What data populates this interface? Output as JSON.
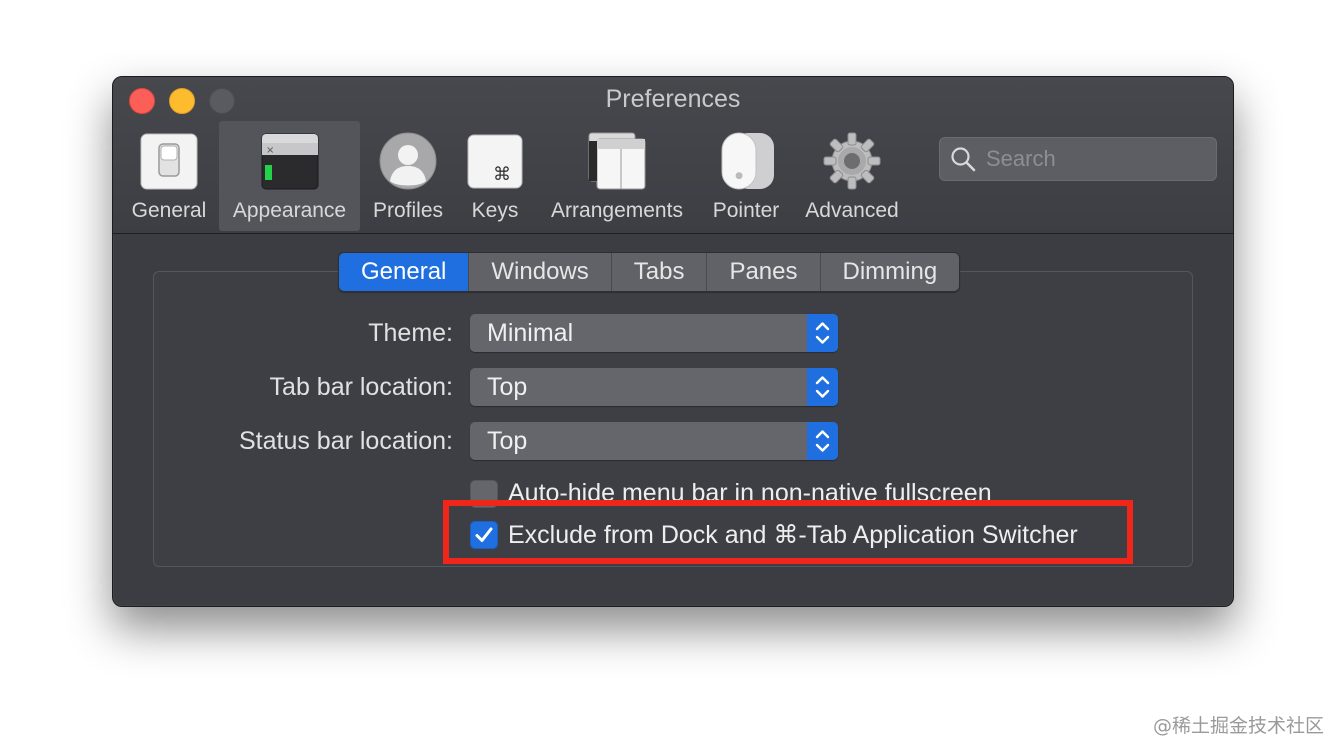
{
  "window": {
    "title": "Preferences"
  },
  "toolbar": {
    "items": [
      {
        "label": "General",
        "icon": "general-switch-icon",
        "selected": false
      },
      {
        "label": "Appearance",
        "icon": "terminal-window-icon",
        "selected": true
      },
      {
        "label": "Profiles",
        "icon": "person-silhouette-icon",
        "selected": false
      },
      {
        "label": "Keys",
        "icon": "command-key-icon",
        "selected": false
      },
      {
        "label": "Arrangements",
        "icon": "windows-arrangement-icon",
        "selected": false
      },
      {
        "label": "Pointer",
        "icon": "mouse-icon",
        "selected": false
      },
      {
        "label": "Advanced",
        "icon": "gear-icon",
        "selected": false
      }
    ]
  },
  "search": {
    "placeholder": "Search"
  },
  "tabs": [
    {
      "label": "General",
      "active": true
    },
    {
      "label": "Windows",
      "active": false
    },
    {
      "label": "Tabs",
      "active": false
    },
    {
      "label": "Panes",
      "active": false
    },
    {
      "label": "Dimming",
      "active": false
    }
  ],
  "form": {
    "theme": {
      "label": "Theme:",
      "value": "Minimal"
    },
    "tab_bar_location": {
      "label": "Tab bar location:",
      "value": "Top"
    },
    "status_bar_location": {
      "label": "Status bar location:",
      "value": "Top"
    },
    "auto_hide": {
      "label": "Auto-hide menu bar in non-native fullscreen",
      "checked": false
    },
    "exclude_dock": {
      "label": "Exclude from Dock and ⌘-Tab Application Switcher",
      "checked": true
    }
  },
  "colors": {
    "accent": "#1f6fe0",
    "highlight_box": "#f0261b",
    "window_bg": "#3c3d42"
  },
  "watermark": "@稀土掘金技术社区"
}
